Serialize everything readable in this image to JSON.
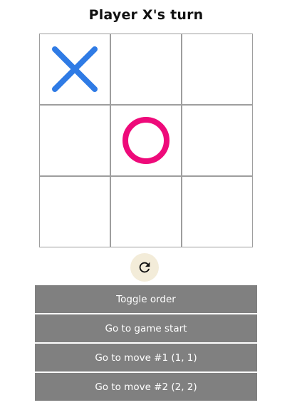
{
  "status": "Player X's turn",
  "board": {
    "cells": [
      "X",
      "",
      "",
      "",
      "O",
      "",
      "",
      "",
      ""
    ],
    "colors": {
      "x": "#2f7be5",
      "o": "#ee0a7a",
      "grid": "#9e9e9e"
    }
  },
  "reset": {
    "icon": "refresh-icon",
    "color": "#111111",
    "background": "#f3ecd9"
  },
  "history": {
    "toggle_label": "Toggle order",
    "moves": [
      "Go to game start",
      "Go to move #1 (1, 1)",
      "Go to move #2 (2, 2)"
    ],
    "button_color": "#808080"
  }
}
